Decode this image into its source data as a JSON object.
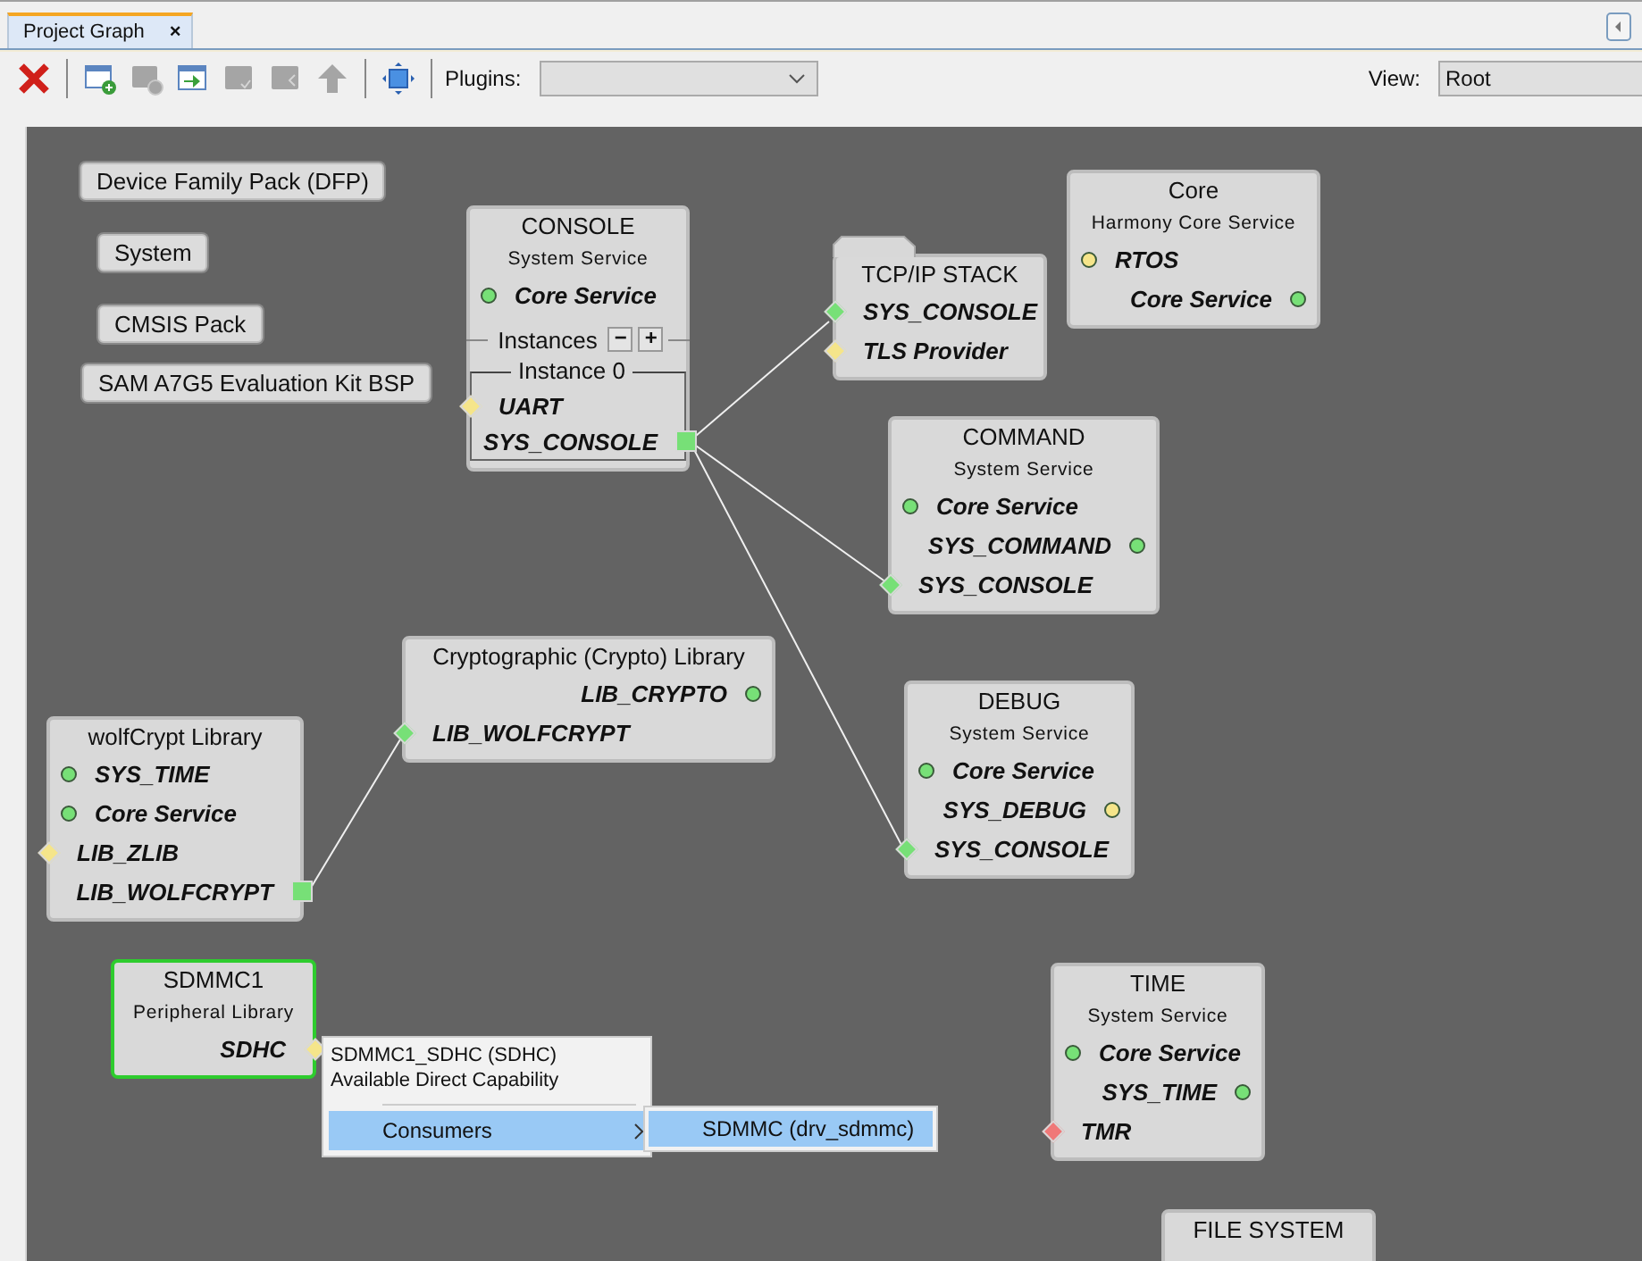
{
  "tab": {
    "label": "Project Graph",
    "close": "×",
    "selected": true
  },
  "toolbar": {
    "buttons": [
      {
        "kind": "delete",
        "disabled": false
      },
      {
        "kind": "add",
        "disabled": false
      },
      {
        "kind": "remove",
        "disabled": true
      },
      {
        "kind": "import",
        "disabled": false
      },
      {
        "kind": "check",
        "disabled": true
      },
      {
        "kind": "back",
        "disabled": true
      },
      {
        "kind": "up",
        "disabled": true
      },
      {
        "kind": "fit",
        "disabled": false
      }
    ],
    "plugins_label": "Plugins:",
    "view_label": "View:",
    "view_value": "Root"
  },
  "packages": [
    {
      "label": "Device Family Pack (DFP)"
    },
    {
      "label": "System"
    },
    {
      "label": "CMSIS Pack"
    },
    {
      "label": "SAM A7G5 Evaluation Kit BSP"
    }
  ],
  "nodes": [
    {
      "title": "CONSOLE",
      "subtitle": "System Service",
      "selected": false,
      "ports": [
        {
          "label": "Core Service",
          "kind": "circle",
          "provides": false,
          "color": "#77e077"
        }
      ],
      "instances": {
        "label": "Instances",
        "minus": "−",
        "plus": "+",
        "group": "Instance 0",
        "ports": [
          {
            "label": "UART",
            "kind": "diamond",
            "provides": false,
            "color": "#f5e58a"
          },
          {
            "label": "SYS_CONSOLE",
            "kind": "square",
            "provides": true,
            "color": "#77e077"
          }
        ]
      }
    },
    {
      "title": "TCP/IP STACK",
      "selected": false,
      "folder": true,
      "ports": [
        {
          "label": "SYS_CONSOLE",
          "kind": "diamond",
          "provides": false,
          "color": "#77e077"
        },
        {
          "label": "TLS Provider",
          "kind": "diamond",
          "provides": false,
          "color": "#f5e58a"
        }
      ]
    },
    {
      "title": "Core",
      "subtitle": "Harmony Core Service",
      "selected": false,
      "ports": [
        {
          "label": "RTOS",
          "kind": "circle",
          "provides": false,
          "color": "#f5e58a"
        },
        {
          "label": "Core Service",
          "kind": "circle",
          "provides": true,
          "color": "#77e077"
        }
      ]
    },
    {
      "title": "COMMAND",
      "subtitle": "System Service",
      "selected": false,
      "ports": [
        {
          "label": "Core Service",
          "kind": "circle",
          "provides": false,
          "color": "#77e077"
        },
        {
          "label": "SYS_COMMAND",
          "kind": "circle",
          "provides": true,
          "color": "#77e077"
        },
        {
          "label": "SYS_CONSOLE",
          "kind": "diamond",
          "provides": false,
          "color": "#77e077"
        }
      ]
    },
    {
      "title": "Cryptographic (Crypto) Library",
      "selected": false,
      "ports": [
        {
          "label": "LIB_CRYPTO",
          "kind": "circle",
          "provides": true,
          "color": "#77e077"
        },
        {
          "label": "LIB_WOLFCRYPT",
          "kind": "diamond",
          "provides": false,
          "color": "#77e077"
        }
      ]
    },
    {
      "title": "wolfCrypt Library",
      "selected": false,
      "ports": [
        {
          "label": "SYS_TIME",
          "kind": "circle",
          "provides": false,
          "color": "#77e077"
        },
        {
          "label": "Core Service",
          "kind": "circle",
          "provides": false,
          "color": "#77e077"
        },
        {
          "label": "LIB_ZLIB",
          "kind": "diamond",
          "provides": false,
          "color": "#f5e58a"
        },
        {
          "label": "LIB_WOLFCRYPT",
          "kind": "square",
          "provides": true,
          "color": "#77e077"
        }
      ]
    },
    {
      "title": "DEBUG",
      "subtitle": "System Service",
      "selected": false,
      "ports": [
        {
          "label": "Core Service",
          "kind": "circle",
          "provides": false,
          "color": "#77e077"
        },
        {
          "label": "SYS_DEBUG",
          "kind": "circle",
          "provides": true,
          "color": "#f5e58a"
        },
        {
          "label": "SYS_CONSOLE",
          "kind": "diamond",
          "provides": false,
          "color": "#77e077"
        }
      ]
    },
    {
      "title": "SDMMC1",
      "subtitle": "Peripheral Library",
      "selected": true,
      "ports": [
        {
          "label": "SDHC",
          "kind": "diamond",
          "provides": true,
          "color": "#f5e58a"
        }
      ]
    },
    {
      "title": "TIME",
      "subtitle": "System Service",
      "selected": false,
      "ports": [
        {
          "label": "Core Service",
          "kind": "circle",
          "provides": false,
          "color": "#77e077"
        },
        {
          "label": "SYS_TIME",
          "kind": "circle",
          "provides": true,
          "color": "#77e077"
        },
        {
          "label": "TMR",
          "kind": "diamond",
          "provides": false,
          "color": "#f07878"
        }
      ]
    },
    {
      "title": "FILE SYSTEM",
      "selected": false
    }
  ],
  "popup": {
    "lines": [
      "SDMMC1_SDHC (SDHC)",
      "Available Direct Capability"
    ],
    "items": [
      {
        "label": "Consumers",
        "selected": true
      }
    ],
    "submenu": [
      {
        "label": "SDMMC (drv_sdmmc)",
        "selected": true
      }
    ]
  }
}
